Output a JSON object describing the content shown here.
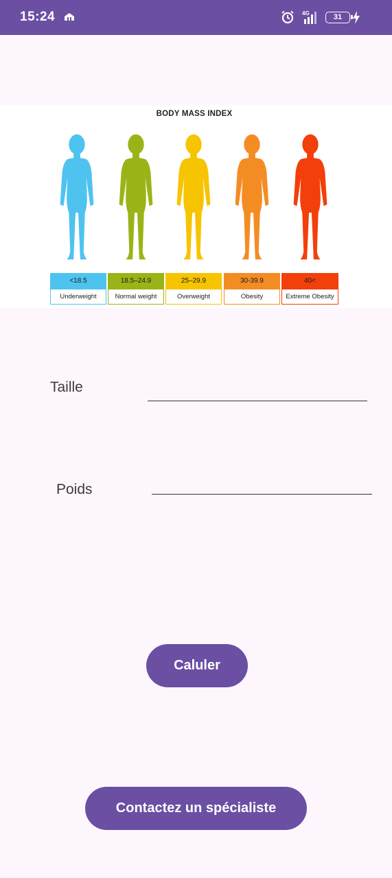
{
  "status_bar": {
    "time": "15:24",
    "battery": "31",
    "network": "4G",
    "icons": [
      "notification-icon",
      "alarm-icon",
      "signal-icon",
      "battery-icon",
      "charging-bolt-icon"
    ]
  },
  "bmi_chart": {
    "title": "BODY MASS INDEX",
    "categories": [
      {
        "range": "<18.5",
        "label": "Underweight",
        "color": "#4fc3f0"
      },
      {
        "range": "18.5–24.9",
        "label": "Normal weight",
        "color": "#9ab418"
      },
      {
        "range": "25–29.9",
        "label": "Overweight",
        "color": "#f6c400"
      },
      {
        "range": "30-39.9",
        "label": "Obesity",
        "color": "#f48c24"
      },
      {
        "range": "40<",
        "label": "Extreme Obesity",
        "color": "#f33f0a"
      }
    ]
  },
  "form": {
    "height_label": "Taille",
    "height_value": "",
    "weight_label": "Poids",
    "weight_value": ""
  },
  "buttons": {
    "calculate": "Caluler",
    "contact": "Contactez un spécialiste"
  },
  "colors": {
    "primary": "#6a4fa3",
    "background": "#fdf7fd"
  }
}
